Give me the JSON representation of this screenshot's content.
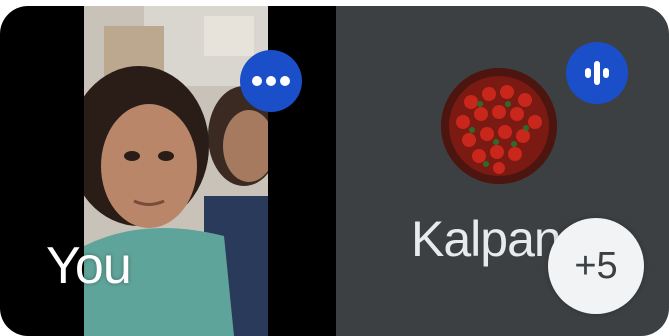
{
  "participants": {
    "self": {
      "label": "You",
      "menu_icon": "more-horizontal-icon"
    },
    "other": {
      "name": "Kalpana",
      "status_icon": "audio-level-icon"
    },
    "overflow_count": "+5"
  },
  "colors": {
    "tile_background": "#3c4043",
    "accent_blue": "#1a4fc9",
    "self_tile_background": "#000000",
    "badge_background": "#f1f3f4"
  }
}
